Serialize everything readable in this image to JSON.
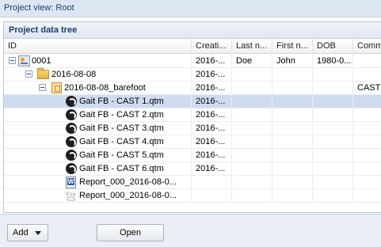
{
  "title_bar": {
    "label": "Project view: Root"
  },
  "panel": {
    "title": "Project data tree"
  },
  "columns": [
    "ID",
    "Creati...",
    "Last n...",
    "First n...",
    "DOB",
    "Comm"
  ],
  "rows": [
    {
      "type": "subject",
      "icon": "subject-icon",
      "id": "0001",
      "created": "2016-...",
      "last": "Doe",
      "first": "John",
      "dob": "1980-0...",
      "comment": ""
    },
    {
      "type": "folder",
      "icon": "folder-icon",
      "id": "2016-08-08",
      "created": "2016-...",
      "last": "",
      "first": "",
      "dob": "",
      "comment": ""
    },
    {
      "type": "session",
      "icon": "session-icon",
      "id": "2016-08-08_barefoot",
      "created": "2016-...",
      "last": "",
      "first": "",
      "dob": "",
      "comment": "CAST"
    },
    {
      "type": "qtm",
      "icon": "qtm-file-icon",
      "id": "Gait FB - CAST 1.qtm",
      "created": "2016-...",
      "last": "",
      "first": "",
      "dob": "",
      "comment": "",
      "selected": true
    },
    {
      "type": "qtm",
      "icon": "qtm-file-icon",
      "id": "Gait FB - CAST 2.qtm",
      "created": "2016-...",
      "last": "",
      "first": "",
      "dob": "",
      "comment": ""
    },
    {
      "type": "qtm",
      "icon": "qtm-file-icon",
      "id": "Gait FB - CAST 3.qtm",
      "created": "2016-...",
      "last": "",
      "first": "",
      "dob": "",
      "comment": ""
    },
    {
      "type": "qtm",
      "icon": "qtm-file-icon",
      "id": "Gait FB - CAST 4.qtm",
      "created": "2016-...",
      "last": "",
      "first": "",
      "dob": "",
      "comment": ""
    },
    {
      "type": "qtm",
      "icon": "qtm-file-icon",
      "id": "Gait FB - CAST 5.qtm",
      "created": "2016-...",
      "last": "",
      "first": "",
      "dob": "",
      "comment": ""
    },
    {
      "type": "qtm",
      "icon": "qtm-file-icon",
      "id": "Gait FB - CAST 6.qtm",
      "created": "2016-...",
      "last": "",
      "first": "",
      "dob": "",
      "comment": ""
    },
    {
      "type": "report",
      "icon": "word-document-icon",
      "id": "Report_000_2016-08-0...",
      "created": "",
      "last": "",
      "first": "",
      "dob": "",
      "comment": ""
    },
    {
      "type": "video",
      "icon": "video-file-icon",
      "id": "Report_000_2016-08-0...",
      "created": "",
      "last": "",
      "first": "",
      "dob": "",
      "comment": ""
    }
  ],
  "buttons": {
    "add": "Add",
    "open": "Open"
  },
  "colors": {
    "selected_row": "#cfdcef",
    "header_text": "#1f3d6b"
  }
}
